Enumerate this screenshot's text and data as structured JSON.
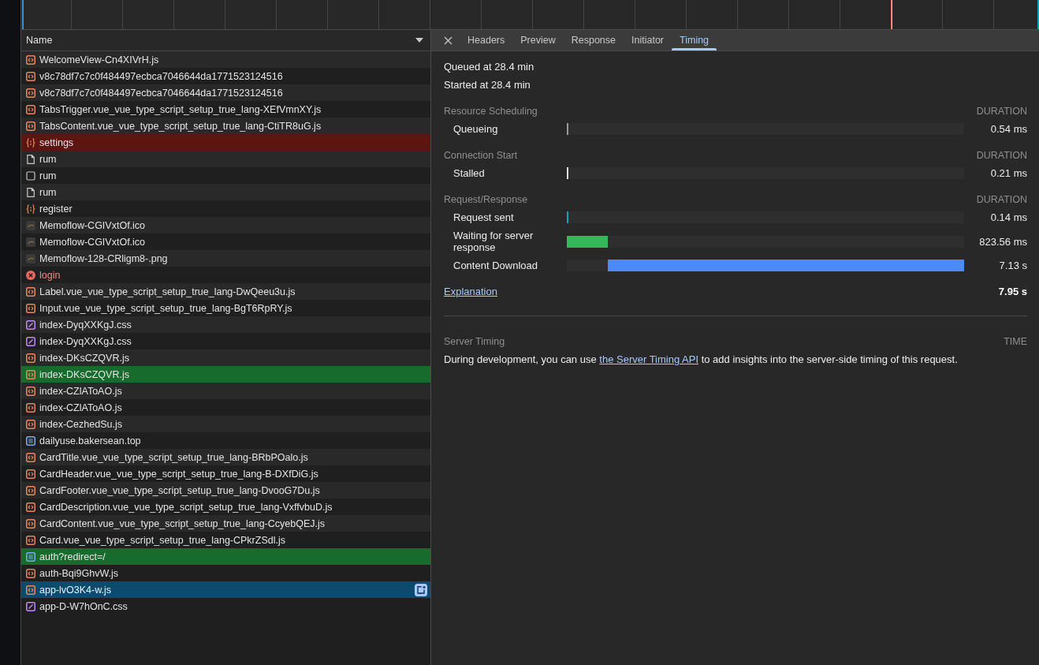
{
  "requests": {
    "column": "Name",
    "rows": [
      {
        "name": "WelcomeView-Cn4XIVrH.js",
        "kind": "script",
        "initiator": false,
        "dependent": false,
        "failed": false,
        "selected": false
      },
      {
        "name": "v8c78df7c7c0f484497ecbca7046644da1771523124516",
        "kind": "script",
        "initiator": false,
        "dependent": false,
        "failed": false,
        "selected": false
      },
      {
        "name": "v8c78df7c7c0f484497ecbca7046644da1771523124516",
        "kind": "script",
        "initiator": false,
        "dependent": false,
        "failed": false,
        "selected": false
      },
      {
        "name": "TabsTrigger.vue_vue_type_script_setup_true_lang-XEfVmnXY.js",
        "kind": "script",
        "initiator": false,
        "dependent": false,
        "failed": false,
        "selected": false
      },
      {
        "name": "TabsContent.vue_vue_type_script_setup_true_lang-CtiTR8uG.js",
        "kind": "script",
        "initiator": false,
        "dependent": false,
        "failed": false,
        "selected": false
      },
      {
        "name": "settings",
        "kind": "fetch",
        "initiator": false,
        "dependent": true,
        "failed": false,
        "selected": false
      },
      {
        "name": "rum",
        "kind": "file",
        "initiator": false,
        "dependent": false,
        "failed": false,
        "selected": false
      },
      {
        "name": "rum",
        "kind": "other",
        "initiator": false,
        "dependent": false,
        "failed": false,
        "selected": false
      },
      {
        "name": "rum",
        "kind": "file",
        "initiator": false,
        "dependent": false,
        "failed": false,
        "selected": false
      },
      {
        "name": "register",
        "kind": "fetch",
        "initiator": false,
        "dependent": false,
        "failed": false,
        "selected": false
      },
      {
        "name": "Memoflow-CGIVxtOf.ico",
        "kind": "image",
        "initiator": false,
        "dependent": false,
        "failed": false,
        "selected": false
      },
      {
        "name": "Memoflow-CGIVxtOf.ico",
        "kind": "image",
        "initiator": false,
        "dependent": false,
        "failed": false,
        "selected": false
      },
      {
        "name": "Memoflow-128-CRligm8-.png",
        "kind": "image",
        "initiator": false,
        "dependent": false,
        "failed": false,
        "selected": false
      },
      {
        "name": "login",
        "kind": "error",
        "initiator": false,
        "dependent": false,
        "failed": true,
        "selected": false
      },
      {
        "name": "Label.vue_vue_type_script_setup_true_lang-DwQeeu3u.js",
        "kind": "script",
        "initiator": false,
        "dependent": false,
        "failed": false,
        "selected": false
      },
      {
        "name": "Input.vue_vue_type_script_setup_true_lang-BgT6RpRY.js",
        "kind": "script",
        "initiator": false,
        "dependent": false,
        "failed": false,
        "selected": false
      },
      {
        "name": "index-DyqXXKgJ.css",
        "kind": "stylesheet",
        "initiator": false,
        "dependent": false,
        "failed": false,
        "selected": false
      },
      {
        "name": "index-DyqXXKgJ.css",
        "kind": "stylesheet",
        "initiator": false,
        "dependent": false,
        "failed": false,
        "selected": false
      },
      {
        "name": "index-DKsCZQVR.js",
        "kind": "script",
        "initiator": false,
        "dependent": false,
        "failed": false,
        "selected": false
      },
      {
        "name": "index-DKsCZQVR.js",
        "kind": "script",
        "initiator": true,
        "dependent": false,
        "failed": false,
        "selected": false
      },
      {
        "name": "index-CZlAToAO.js",
        "kind": "script",
        "initiator": false,
        "dependent": false,
        "failed": false,
        "selected": false
      },
      {
        "name": "index-CZlAToAO.js",
        "kind": "script",
        "initiator": false,
        "dependent": false,
        "failed": false,
        "selected": false
      },
      {
        "name": "index-CezhedSu.js",
        "kind": "script",
        "initiator": false,
        "dependent": false,
        "failed": false,
        "selected": false
      },
      {
        "name": "dailyuse.bakersean.top",
        "kind": "document",
        "initiator": false,
        "dependent": false,
        "failed": false,
        "selected": false
      },
      {
        "name": "CardTitle.vue_vue_type_script_setup_true_lang-BRbPOalo.js",
        "kind": "script",
        "initiator": false,
        "dependent": false,
        "failed": false,
        "selected": false
      },
      {
        "name": "CardHeader.vue_vue_type_script_setup_true_lang-B-DXfDiG.js",
        "kind": "script",
        "initiator": false,
        "dependent": false,
        "failed": false,
        "selected": false
      },
      {
        "name": "CardFooter.vue_vue_type_script_setup_true_lang-DvooG7Du.js",
        "kind": "script",
        "initiator": false,
        "dependent": false,
        "failed": false,
        "selected": false
      },
      {
        "name": "CardDescription.vue_vue_type_script_setup_true_lang-VxffvbuD.js",
        "kind": "script",
        "initiator": false,
        "dependent": false,
        "failed": false,
        "selected": false
      },
      {
        "name": "CardContent.vue_vue_type_script_setup_true_lang-CcyebQEJ.js",
        "kind": "script",
        "initiator": false,
        "dependent": false,
        "failed": false,
        "selected": false
      },
      {
        "name": "Card.vue_vue_type_script_setup_true_lang-CPkrZSdl.js",
        "kind": "script",
        "initiator": false,
        "dependent": false,
        "failed": false,
        "selected": false
      },
      {
        "name": "auth?redirect=/",
        "kind": "document",
        "initiator": true,
        "dependent": false,
        "failed": false,
        "selected": false
      },
      {
        "name": "auth-Bqi9GhvW.js",
        "kind": "script",
        "initiator": false,
        "dependent": false,
        "failed": false,
        "selected": false
      },
      {
        "name": "app-lvO3K4-w.js",
        "kind": "script",
        "initiator": false,
        "dependent": false,
        "failed": false,
        "selected": true
      },
      {
        "name": "app-D-W7hOnC.css",
        "kind": "stylesheet",
        "initiator": false,
        "dependent": false,
        "failed": false,
        "selected": false
      }
    ]
  },
  "details": {
    "tabs": [
      {
        "label": "Headers",
        "selected": false
      },
      {
        "label": "Preview",
        "selected": false
      },
      {
        "label": "Response",
        "selected": false
      },
      {
        "label": "Initiator",
        "selected": false
      },
      {
        "label": "Timing",
        "selected": true
      }
    ],
    "queued": "Queued at 28.4 min",
    "started": "Started at 28.4 min",
    "sections": [
      {
        "title": "Resource Scheduling",
        "column": "DURATION",
        "phases": [
          {
            "label": "Queueing",
            "duration": "0.54 ms",
            "level": 0.0001,
            "color": "#9a9a9a"
          }
        ]
      },
      {
        "title": "Connection Start",
        "column": "DURATION",
        "phases": [
          {
            "label": "Stalled",
            "duration": "0.21 ms",
            "level": 3e-05,
            "color": "#e8e8e8"
          }
        ]
      },
      {
        "title": "Request/Response",
        "column": "DURATION",
        "phases": [
          {
            "label": "Request sent",
            "duration": "0.14 ms",
            "level": 2e-05,
            "color": "#12a1b3"
          },
          {
            "label": "Waiting for server response",
            "duration": "823.56 ms",
            "level": 0.1036,
            "color": "#34b85a"
          },
          {
            "label": "Content Download",
            "duration": "7.13 s",
            "level": 0.8962,
            "color": "#4c8bf5"
          }
        ]
      }
    ],
    "explanation": {
      "link": "Explanation",
      "total": "7.95 s"
    },
    "server_timing": {
      "title": "Server Timing",
      "column": "TIME",
      "note_before": "During development, you can use ",
      "link": "the Server Timing API",
      "note_after": " to add insights into the server-side timing of this request."
    }
  }
}
